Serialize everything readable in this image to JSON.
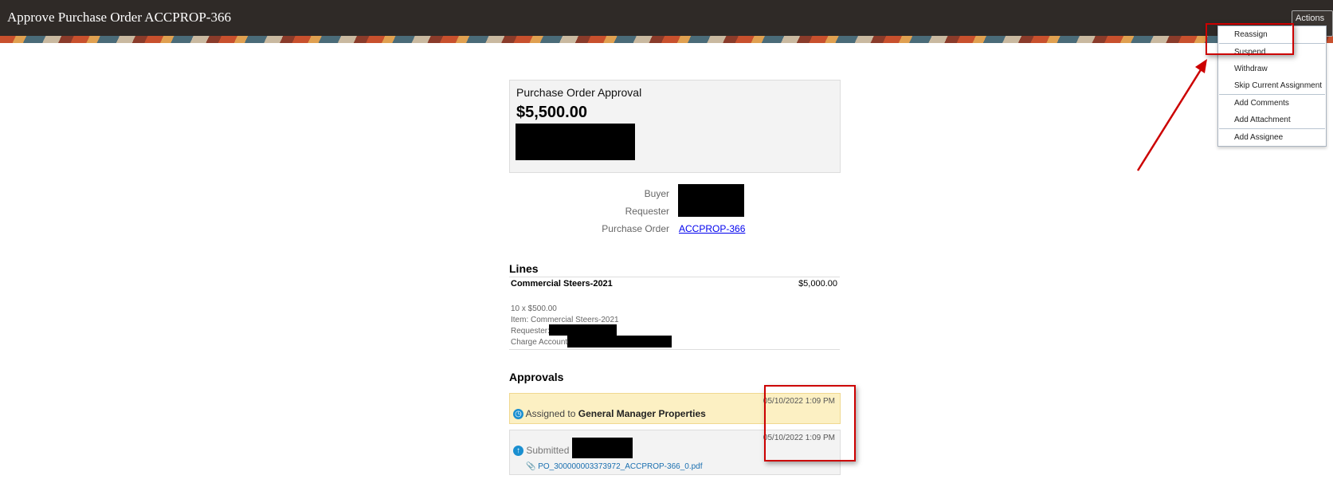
{
  "header": {
    "title": "Approve Purchase Order ACCPROP-366",
    "actions_label": "Actions"
  },
  "menu": {
    "groups": [
      [
        "Reassign"
      ],
      [
        "Suspend",
        "Withdraw",
        "Skip Current Assignment"
      ],
      [
        "Add Comments",
        "Add Attachment"
      ],
      [
        "Add Assignee"
      ]
    ]
  },
  "summary": {
    "title": "Purchase Order Approval",
    "amount": "$5,500.00"
  },
  "details": {
    "buyer_label": "Buyer",
    "requester_label": "Requester",
    "po_label": "Purchase Order",
    "po_value": "ACCPROP-366"
  },
  "lines": {
    "heading": "Lines",
    "item_name": "Commercial Steers-2021",
    "item_amount": "$5,000.00",
    "qty": "10 x $500.00",
    "item": "Item: Commercial Steers-2021",
    "requester": "Requester:",
    "charge": "Charge Account:"
  },
  "approvals": {
    "heading": "Approvals",
    "assigned_prefix": "Assigned to",
    "assignee": "General Manager Properties",
    "assigned_date": "05/10/2022 1:09 PM",
    "submitted_prefix": "Submitted by",
    "submitted_date": "05/10/2022 1:09 PM",
    "attachment": "PO_300000003373972_ACCPROP-366_0.pdf"
  },
  "colors": {
    "annotation": "#cc0000",
    "assigned_bg": "#fcf0c3",
    "icon": "#1a8fd0"
  }
}
